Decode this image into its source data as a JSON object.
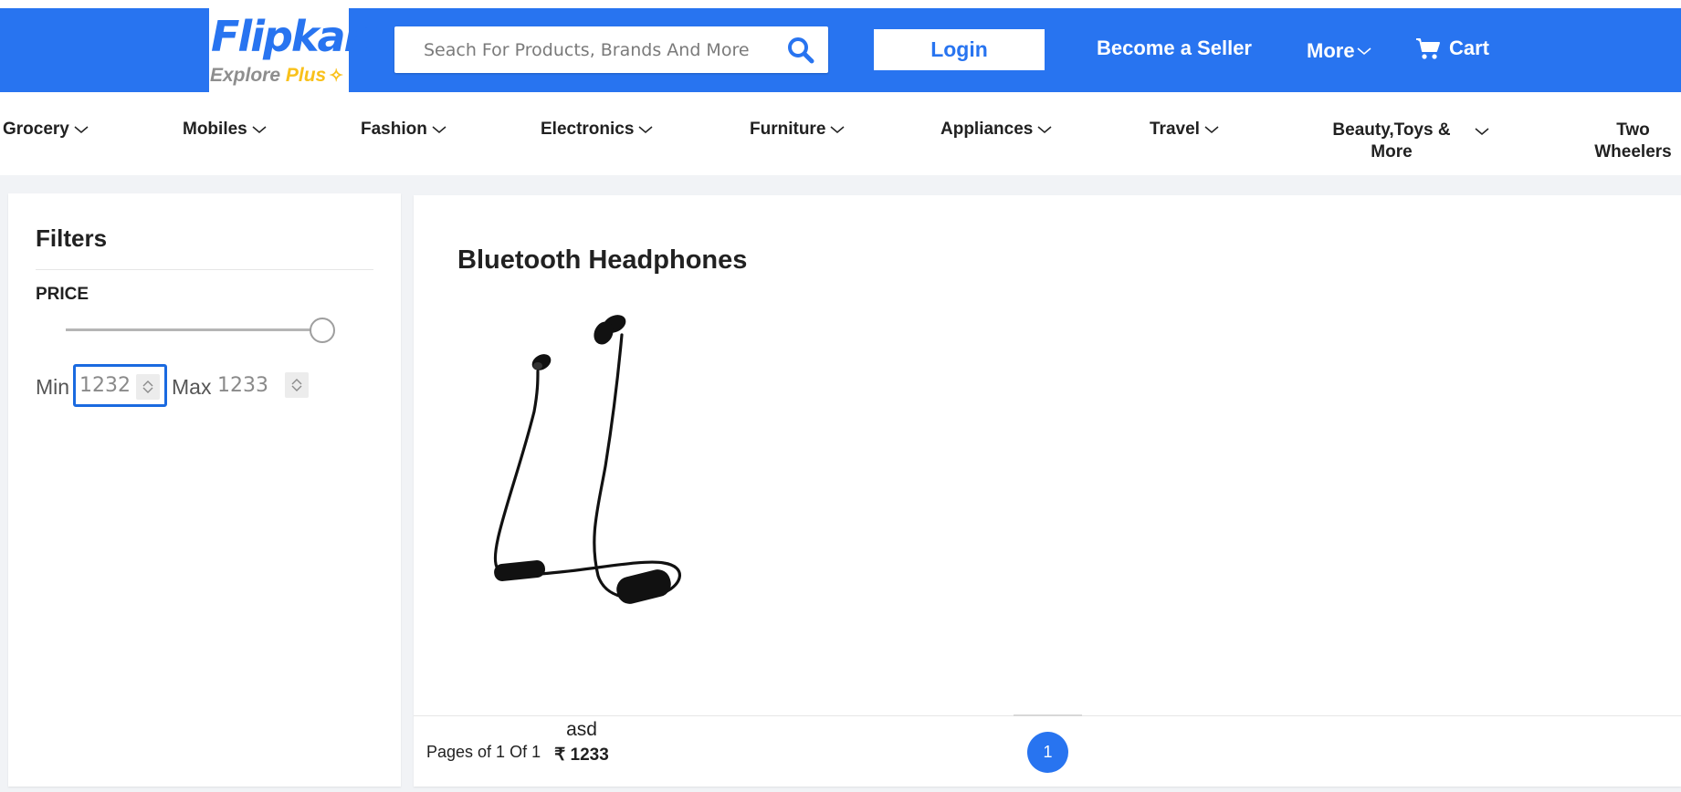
{
  "brand": {
    "primary": "#2874f0",
    "accent": "#f9c11b",
    "name": "Flipkart",
    "tagline_explore": "Explore",
    "tagline_plus": "Plus",
    "plus_icon": "sparkle-icon"
  },
  "header": {
    "search_placeholder": "Seach For Products, Brands And More",
    "search_icon": "search-icon",
    "login_label": "Login",
    "seller_label": "Become a Seller",
    "more_label": "More",
    "cart_label": "Cart",
    "cart_icon": "cart-icon"
  },
  "categories": [
    {
      "label": "Grocery"
    },
    {
      "label": "Mobiles"
    },
    {
      "label": "Fashion"
    },
    {
      "label": "Electronics"
    },
    {
      "label": "Furniture"
    },
    {
      "label": "Appliances"
    },
    {
      "label": "Travel"
    },
    {
      "label_line1": "Beauty,Toys &",
      "label_line2": "More"
    },
    {
      "label_line1": "Two",
      "label_line2": "Wheelers"
    }
  ],
  "filters": {
    "title": "Filters",
    "price_label": "PRICE",
    "slider_level": 1.0,
    "min_label": "Min",
    "min_value": "1232",
    "max_label": "Max",
    "max_value": "1233"
  },
  "listing": {
    "title": "Bluetooth Headphones",
    "products": [
      {
        "name": "asd",
        "price": "₹ 1233",
        "image": "bluetooth-neckband-headphones"
      }
    ]
  },
  "pagination": {
    "text": "Pages of 1 Of 1",
    "current_page": "1"
  }
}
